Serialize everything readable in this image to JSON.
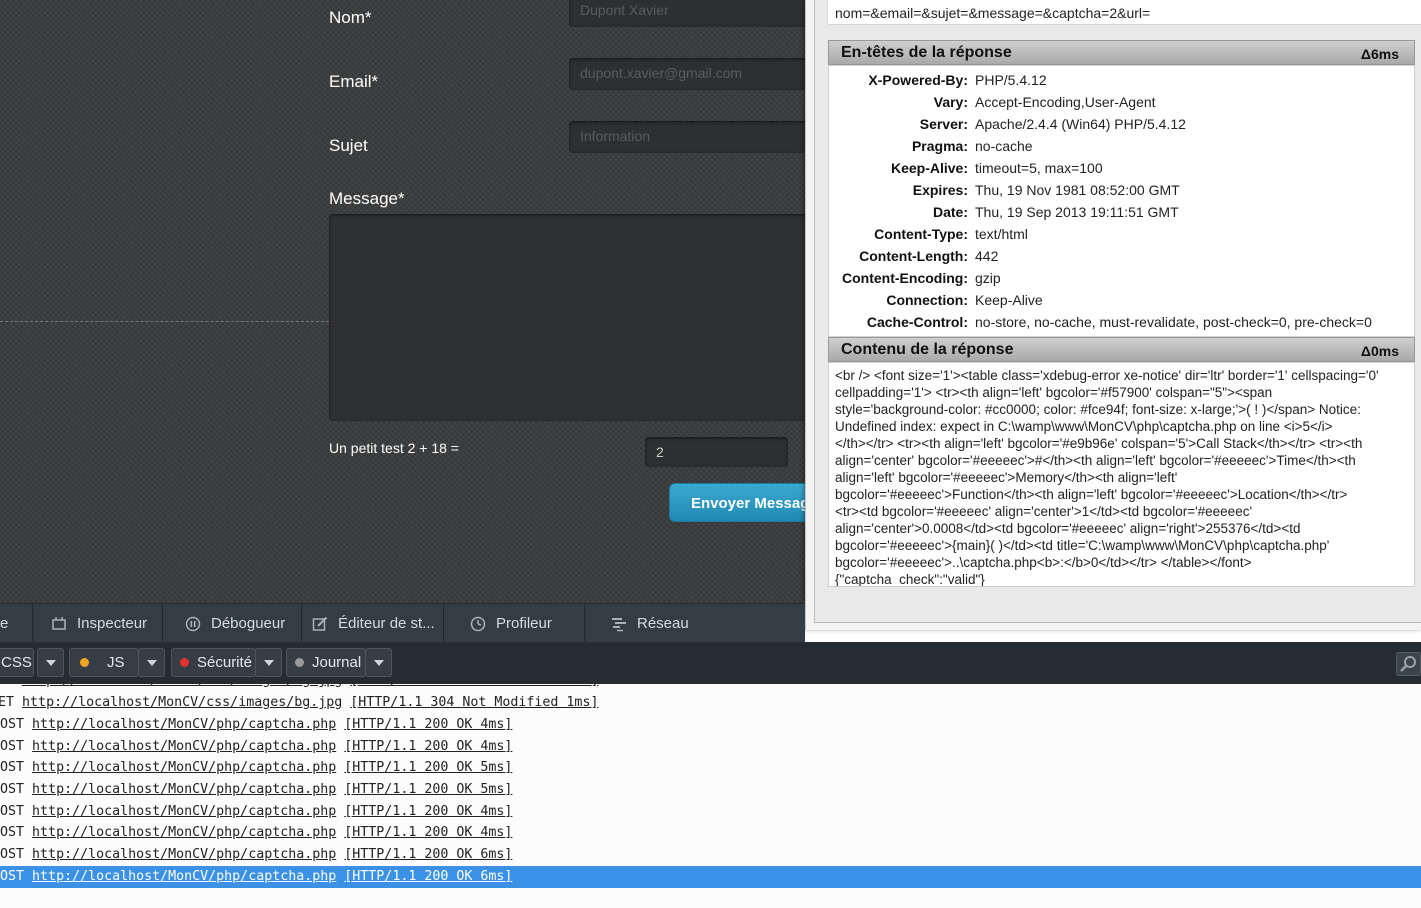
{
  "form": {
    "nom_label": "Nom*",
    "nom_value": "Dupont Xavier",
    "email_label": "Email*",
    "email_value": "dupont.xavier@gmail.com",
    "sujet_label": "Sujet",
    "sujet_value": "Information",
    "message_label": "Message*",
    "captcha_question": "Un petit test 2 + 18 =",
    "captcha_answer": "2",
    "send_label": "Envoyer Message"
  },
  "devtools": {
    "tabs": [
      {
        "label": "e",
        "icon": "console-icon"
      },
      {
        "label": "Inspecteur",
        "icon": "inspector-icon"
      },
      {
        "label": "Débogueur",
        "icon": "pause-icon"
      },
      {
        "label": "Éditeur de st...",
        "icon": "edit-icon"
      },
      {
        "label": "Profileur",
        "icon": "clock-icon"
      },
      {
        "label": "Réseau",
        "icon": "network-icon"
      }
    ],
    "filters": [
      {
        "label": "CSS",
        "dot": ""
      },
      {
        "label": "JS",
        "dot": "#f0a520"
      },
      {
        "label": "Sécurité",
        "dot": "#e3312f"
      },
      {
        "label": "Journal",
        "dot": "#9a9a9a"
      }
    ]
  },
  "console": {
    "rows": [
      {
        "method": "GET",
        "url": "http://localhost/MonCV/css/images/bg.jpg",
        "status": "[HTTP/1.1 304 Not Modified 1ms]"
      },
      {
        "method": "GET",
        "url": "http://localhost/MonCV/css/images/bg.jpg",
        "status": "[HTTP/1.1 304 Not Modified 1ms]"
      },
      {
        "method": "POST",
        "url": "http://localhost/MonCV/php/captcha.php",
        "status": "[HTTP/1.1 200 OK 4ms]"
      },
      {
        "method": "POST",
        "url": "http://localhost/MonCV/php/captcha.php",
        "status": "[HTTP/1.1 200 OK 4ms]"
      },
      {
        "method": "POST",
        "url": "http://localhost/MonCV/php/captcha.php",
        "status": "[HTTP/1.1 200 OK 5ms]"
      },
      {
        "method": "POST",
        "url": "http://localhost/MonCV/php/captcha.php",
        "status": "[HTTP/1.1 200 OK 5ms]"
      },
      {
        "method": "POST",
        "url": "http://localhost/MonCV/php/captcha.php",
        "status": "[HTTP/1.1 200 OK 4ms]"
      },
      {
        "method": "POST",
        "url": "http://localhost/MonCV/php/captcha.php",
        "status": "[HTTP/1.1 200 OK 4ms]"
      },
      {
        "method": "POST",
        "url": "http://localhost/MonCV/php/captcha.php",
        "status": "[HTTP/1.1 200 OK 6ms]"
      },
      {
        "method": "POST",
        "url": "http://localhost/MonCV/php/captcha.php",
        "status": "[HTTP/1.1 200 OK 6ms]"
      }
    ],
    "selected_index": 9
  },
  "net_panel": {
    "query_string": "nom=&email=&sujet=&message=&captcha=2&url=",
    "headers_title": "En-têtes de la réponse",
    "headers_time": "Δ6ms",
    "headers": [
      {
        "k": "X-Powered-By:",
        "v": "PHP/5.4.12"
      },
      {
        "k": "Vary:",
        "v": "Accept-Encoding,User-Agent"
      },
      {
        "k": "Server:",
        "v": "Apache/2.4.4 (Win64) PHP/5.4.12"
      },
      {
        "k": "Pragma:",
        "v": "no-cache"
      },
      {
        "k": "Keep-Alive:",
        "v": "timeout=5, max=100"
      },
      {
        "k": "Expires:",
        "v": "Thu, 19 Nov 1981 08:52:00 GMT"
      },
      {
        "k": "Date:",
        "v": "Thu, 19 Sep 2013 19:11:51 GMT"
      },
      {
        "k": "Content-Type:",
        "v": "text/html"
      },
      {
        "k": "Content-Length:",
        "v": "442"
      },
      {
        "k": "Content-Encoding:",
        "v": "gzip"
      },
      {
        "k": "Connection:",
        "v": "Keep-Alive"
      },
      {
        "k": "Cache-Control:",
        "v": "no-store, no-cache, must-revalidate, post-check=0, pre-check=0"
      }
    ],
    "content_title": "Contenu de la réponse",
    "content_time": "Δ0ms",
    "content_lines": [
      "<br /> <font size='1'><table class='xdebug-error xe-notice' dir='ltr' border='1' cellspacing='0'",
      "cellpadding='1'> <tr><th align='left' bgcolor='#f57900' colspan=\"5\"><span",
      "style='background-color: #cc0000; color: #fce94f; font-size: x-large;'>( ! )</span> Notice:",
      "Undefined index: expect in C:\\wamp\\www\\MonCV\\php\\captcha.php on line <i>5</i>",
      "</th></tr> <tr><th align='left' bgcolor='#e9b96e' colspan='5'>Call Stack</th></tr> <tr><th",
      "align='center' bgcolor='#eeeeec'>#</th><th align='left' bgcolor='#eeeeec'>Time</th><th",
      "align='left' bgcolor='#eeeeec'>Memory</th><th align='left'",
      "bgcolor='#eeeeec'>Function</th><th align='left' bgcolor='#eeeeec'>Location</th></tr>",
      "<tr><td bgcolor='#eeeeec' align='center'>1</td><td bgcolor='#eeeeec'",
      "align='center'>0.0008</td><td bgcolor='#eeeeec' align='right'>255376</td><td",
      "bgcolor='#eeeeec'>{main}( )</td><td title='C:\\wamp\\www\\MonCV\\php\\captcha.php'",
      "bgcolor='#eeeeec'>..\\captcha.php<b>:</b>0</td></tr> </table></font>",
      "{\"captcha_check\":\"valid\"}"
    ]
  }
}
